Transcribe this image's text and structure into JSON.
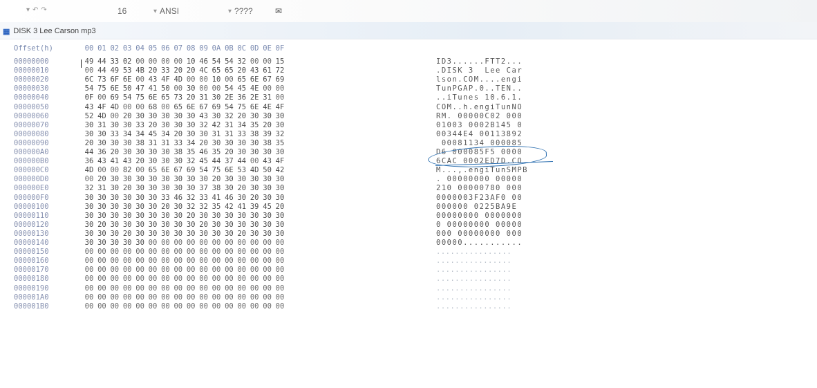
{
  "toolbar": {
    "font_size": "16",
    "encoding": "ANSI",
    "extra": "????"
  },
  "tab": {
    "icon": "hex-file-icon",
    "title": "DISK 3 Lee Carson mp3"
  },
  "hex": {
    "offset_header": "Offset(h)",
    "columns": [
      "00",
      "01",
      "02",
      "03",
      "04",
      "05",
      "06",
      "07",
      "08",
      "09",
      "0A",
      "0B",
      "0C",
      "0D",
      "0E",
      "0F"
    ],
    "rows": [
      {
        "offset": "00000000",
        "bytes": [
          "49",
          "44",
          "33",
          "02",
          "00",
          "00",
          "00",
          "00",
          "10",
          "46",
          "54",
          "54",
          "32",
          "00",
          "00",
          "15"
        ],
        "ascii": "ID3......FTT2..."
      },
      {
        "offset": "00000010",
        "bytes": [
          "00",
          "44",
          "49",
          "53",
          "4B",
          "20",
          "33",
          "20",
          "20",
          "4C",
          "65",
          "65",
          "20",
          "43",
          "61",
          "72"
        ],
        "ascii": ".DISK 3  Lee Car"
      },
      {
        "offset": "00000020",
        "bytes": [
          "6C",
          "73",
          "6F",
          "6E",
          "00",
          "43",
          "4F",
          "4D",
          "00",
          "00",
          "10",
          "00",
          "65",
          "6E",
          "67",
          "69"
        ],
        "ascii": "lson.COM....engi"
      },
      {
        "offset": "00000030",
        "bytes": [
          "54",
          "75",
          "6E",
          "50",
          "47",
          "41",
          "50",
          "00",
          "30",
          "00",
          "00",
          "54",
          "45",
          "4E",
          "00",
          "00"
        ],
        "ascii": "TunPGAP.0..TEN.."
      },
      {
        "offset": "00000040",
        "bytes": [
          "0F",
          "00",
          "69",
          "54",
          "75",
          "6E",
          "65",
          "73",
          "20",
          "31",
          "30",
          "2E",
          "36",
          "2E",
          "31",
          "00"
        ],
        "ascii": "..iTunes 10.6.1."
      },
      {
        "offset": "00000050",
        "bytes": [
          "43",
          "4F",
          "4D",
          "00",
          "00",
          "68",
          "00",
          "65",
          "6E",
          "67",
          "69",
          "54",
          "75",
          "6E",
          "4E",
          "4F"
        ],
        "ascii": "COM..h.engiTunNO"
      },
      {
        "offset": "00000060",
        "bytes": [
          "52",
          "4D",
          "00",
          "20",
          "30",
          "30",
          "30",
          "30",
          "30",
          "43",
          "30",
          "32",
          "20",
          "30",
          "30",
          "30"
        ],
        "ascii": "RM. 00000C02 000"
      },
      {
        "offset": "00000070",
        "bytes": [
          "30",
          "31",
          "30",
          "30",
          "33",
          "20",
          "30",
          "30",
          "30",
          "32",
          "42",
          "31",
          "34",
          "35",
          "20",
          "30"
        ],
        "ascii": "01003 0002B145 0"
      },
      {
        "offset": "00000080",
        "bytes": [
          "30",
          "30",
          "33",
          "34",
          "34",
          "45",
          "34",
          "20",
          "30",
          "30",
          "31",
          "31",
          "33",
          "38",
          "39",
          "32"
        ],
        "ascii": "00344E4 00113892"
      },
      {
        "offset": "00000090",
        "bytes": [
          "20",
          "30",
          "30",
          "30",
          "38",
          "31",
          "31",
          "33",
          "34",
          "20",
          "30",
          "30",
          "30",
          "30",
          "38",
          "35"
        ],
        "ascii": " 00081134 000085"
      },
      {
        "offset": "000000A0",
        "bytes": [
          "44",
          "36",
          "20",
          "30",
          "30",
          "30",
          "30",
          "38",
          "35",
          "46",
          "35",
          "20",
          "30",
          "30",
          "30",
          "30"
        ],
        "ascii": "D6 000085F5 0000"
      },
      {
        "offset": "000000B0",
        "bytes": [
          "36",
          "43",
          "41",
          "43",
          "20",
          "30",
          "30",
          "30",
          "32",
          "45",
          "44",
          "37",
          "44",
          "00",
          "43",
          "4F"
        ],
        "ascii": "6CAC 0002ED7D.CO"
      },
      {
        "offset": "000000C0",
        "bytes": [
          "4D",
          "00",
          "00",
          "82",
          "00",
          "65",
          "6E",
          "67",
          "69",
          "54",
          "75",
          "6E",
          "53",
          "4D",
          "50",
          "42"
        ],
        "ascii": "M...,.engiTunSMPB"
      },
      {
        "offset": "000000D0",
        "bytes": [
          "00",
          "20",
          "30",
          "30",
          "30",
          "30",
          "30",
          "30",
          "30",
          "30",
          "20",
          "30",
          "30",
          "30",
          "30",
          "30"
        ],
        "ascii": ". 00000000 00000"
      },
      {
        "offset": "000000E0",
        "bytes": [
          "32",
          "31",
          "30",
          "20",
          "30",
          "30",
          "30",
          "30",
          "30",
          "37",
          "38",
          "30",
          "20",
          "30",
          "30",
          "30"
        ],
        "ascii": "210 00000780 000"
      },
      {
        "offset": "000000F0",
        "bytes": [
          "30",
          "30",
          "30",
          "30",
          "30",
          "30",
          "33",
          "46",
          "32",
          "33",
          "41",
          "46",
          "30",
          "20",
          "30",
          "30"
        ],
        "ascii": "0000003F23AF0 00"
      },
      {
        "offset": "00000100",
        "bytes": [
          "30",
          "30",
          "30",
          "30",
          "30",
          "30",
          "20",
          "30",
          "32",
          "32",
          "35",
          "42",
          "41",
          "39",
          "45",
          "20"
        ],
        "ascii": "000000 0225BA9E "
      },
      {
        "offset": "00000110",
        "bytes": [
          "30",
          "30",
          "30",
          "30",
          "30",
          "30",
          "30",
          "30",
          "20",
          "30",
          "30",
          "30",
          "30",
          "30",
          "30",
          "30"
        ],
        "ascii": "00000000 0000000"
      },
      {
        "offset": "00000120",
        "bytes": [
          "30",
          "20",
          "30",
          "30",
          "30",
          "30",
          "30",
          "30",
          "30",
          "20",
          "30",
          "30",
          "30",
          "30",
          "30",
          "30"
        ],
        "ascii": "0 00000000 00000"
      },
      {
        "offset": "00000130",
        "bytes": [
          "30",
          "30",
          "30",
          "20",
          "30",
          "30",
          "30",
          "30",
          "30",
          "30",
          "30",
          "30",
          "20",
          "30",
          "30",
          "30"
        ],
        "ascii": "000 00000000 000"
      },
      {
        "offset": "00000140",
        "bytes": [
          "30",
          "30",
          "30",
          "30",
          "30",
          "00",
          "00",
          "00",
          "00",
          "00",
          "00",
          "00",
          "00",
          "00",
          "00",
          "00"
        ],
        "ascii": "00000..........."
      },
      {
        "offset": "00000150",
        "bytes": [
          "00",
          "00",
          "00",
          "00",
          "00",
          "00",
          "00",
          "00",
          "00",
          "00",
          "00",
          "00",
          "00",
          "00",
          "00",
          "00"
        ],
        "ascii": "................"
      },
      {
        "offset": "00000160",
        "bytes": [
          "00",
          "00",
          "00",
          "00",
          "00",
          "00",
          "00",
          "00",
          "00",
          "00",
          "00",
          "00",
          "00",
          "00",
          "00",
          "00"
        ],
        "ascii": "................"
      },
      {
        "offset": "00000170",
        "bytes": [
          "00",
          "00",
          "00",
          "00",
          "00",
          "00",
          "00",
          "00",
          "00",
          "00",
          "00",
          "00",
          "00",
          "00",
          "00",
          "00"
        ],
        "ascii": "................"
      },
      {
        "offset": "00000180",
        "bytes": [
          "00",
          "00",
          "00",
          "00",
          "00",
          "00",
          "00",
          "00",
          "00",
          "00",
          "00",
          "00",
          "00",
          "00",
          "00",
          "00"
        ],
        "ascii": "................"
      },
      {
        "offset": "00000190",
        "bytes": [
          "00",
          "00",
          "00",
          "00",
          "00",
          "00",
          "00",
          "00",
          "00",
          "00",
          "00",
          "00",
          "00",
          "00",
          "00",
          "00"
        ],
        "ascii": "................"
      },
      {
        "offset": "000001A0",
        "bytes": [
          "00",
          "00",
          "00",
          "00",
          "00",
          "00",
          "00",
          "00",
          "00",
          "00",
          "00",
          "00",
          "00",
          "00",
          "00",
          "00"
        ],
        "ascii": "................"
      },
      {
        "offset": "000001B0",
        "bytes": [
          "00",
          "00",
          "00",
          "00",
          "00",
          "00",
          "00",
          "00",
          "00",
          "00",
          "00",
          "00",
          "00",
          "00",
          "00",
          "00"
        ],
        "ascii": "................"
      }
    ]
  },
  "colors": {
    "offset_text": "#8791b0",
    "annotation": "#2c6fb0"
  }
}
